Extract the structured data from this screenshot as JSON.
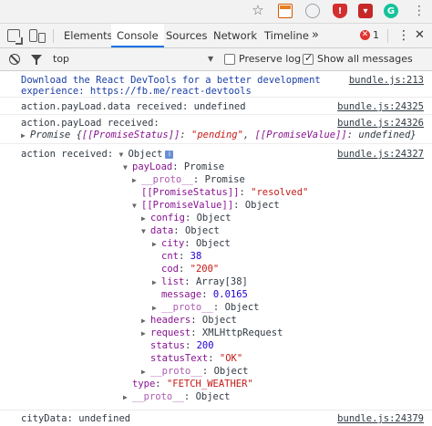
{
  "devtools": {
    "tabs": [
      "Elements",
      "Console",
      "Sources",
      "Network",
      "Timeline"
    ],
    "active_tab": "Console",
    "more_tabs": "»",
    "error_count": "1",
    "close": "✕"
  },
  "toolbar": {
    "context": "top",
    "context_arrow": "▼",
    "preserve_log_label": "Preserve log",
    "preserve_log_checked": false,
    "show_all_label": "Show all messages",
    "show_all_checked": true
  },
  "messages": {
    "m1": {
      "line1": "Download the React DevTools for a better development",
      "line2": "experience: https://fb.me/react-devtools",
      "source": "bundle.js:213"
    },
    "m2": {
      "text": "action.payLoad.data received: undefined",
      "source": "bundle.js:24325"
    },
    "m3": {
      "text": "action.payLoad received:",
      "source": "bundle.js:24326",
      "promise_label": "Promise {",
      "status_key": "[[PromiseStatus]]",
      "status_value": "\"pending\"",
      "value_key": "[[PromiseValue]]",
      "value_value": "undefined"
    },
    "m4": {
      "prefix": "action received:",
      "object": "Object",
      "source": "bundle.js:24327",
      "tree": {
        "payLoad_key": "payLoad",
        "payLoad_val": "Promise",
        "proto1_key": "__proto__",
        "proto1_val": "Promise",
        "pstatus_key": "[[PromiseStatus]]",
        "pstatus_val": "\"resolved\"",
        "pvalue_key": "[[PromiseValue]]",
        "pvalue_val": "Object",
        "config_key": "config",
        "config_val": "Object",
        "data_key": "data",
        "data_val": "Object",
        "city_key": "city",
        "city_val": "Object",
        "cnt_key": "cnt",
        "cnt_val": "38",
        "cod_key": "cod",
        "cod_val": "\"200\"",
        "list_key": "list",
        "list_val": "Array[38]",
        "message_key": "message",
        "message_val": "0.0165",
        "proto2_key": "__proto__",
        "proto2_val": "Object",
        "headers_key": "headers",
        "headers_val": "Object",
        "request_key": "request",
        "request_val": "XMLHttpRequest",
        "status_key": "status",
        "status_val": "200",
        "statusText_key": "statusText",
        "statusText_val": "\"OK\"",
        "proto3_key": "__proto__",
        "proto3_val": "Object",
        "type_key": "type",
        "type_val": "\"FETCH_WEATHER\"",
        "proto4_key": "__proto__",
        "proto4_val": "Object"
      }
    },
    "m5": {
      "text": "cityData: undefined",
      "source": "bundle.js:24379"
    }
  }
}
